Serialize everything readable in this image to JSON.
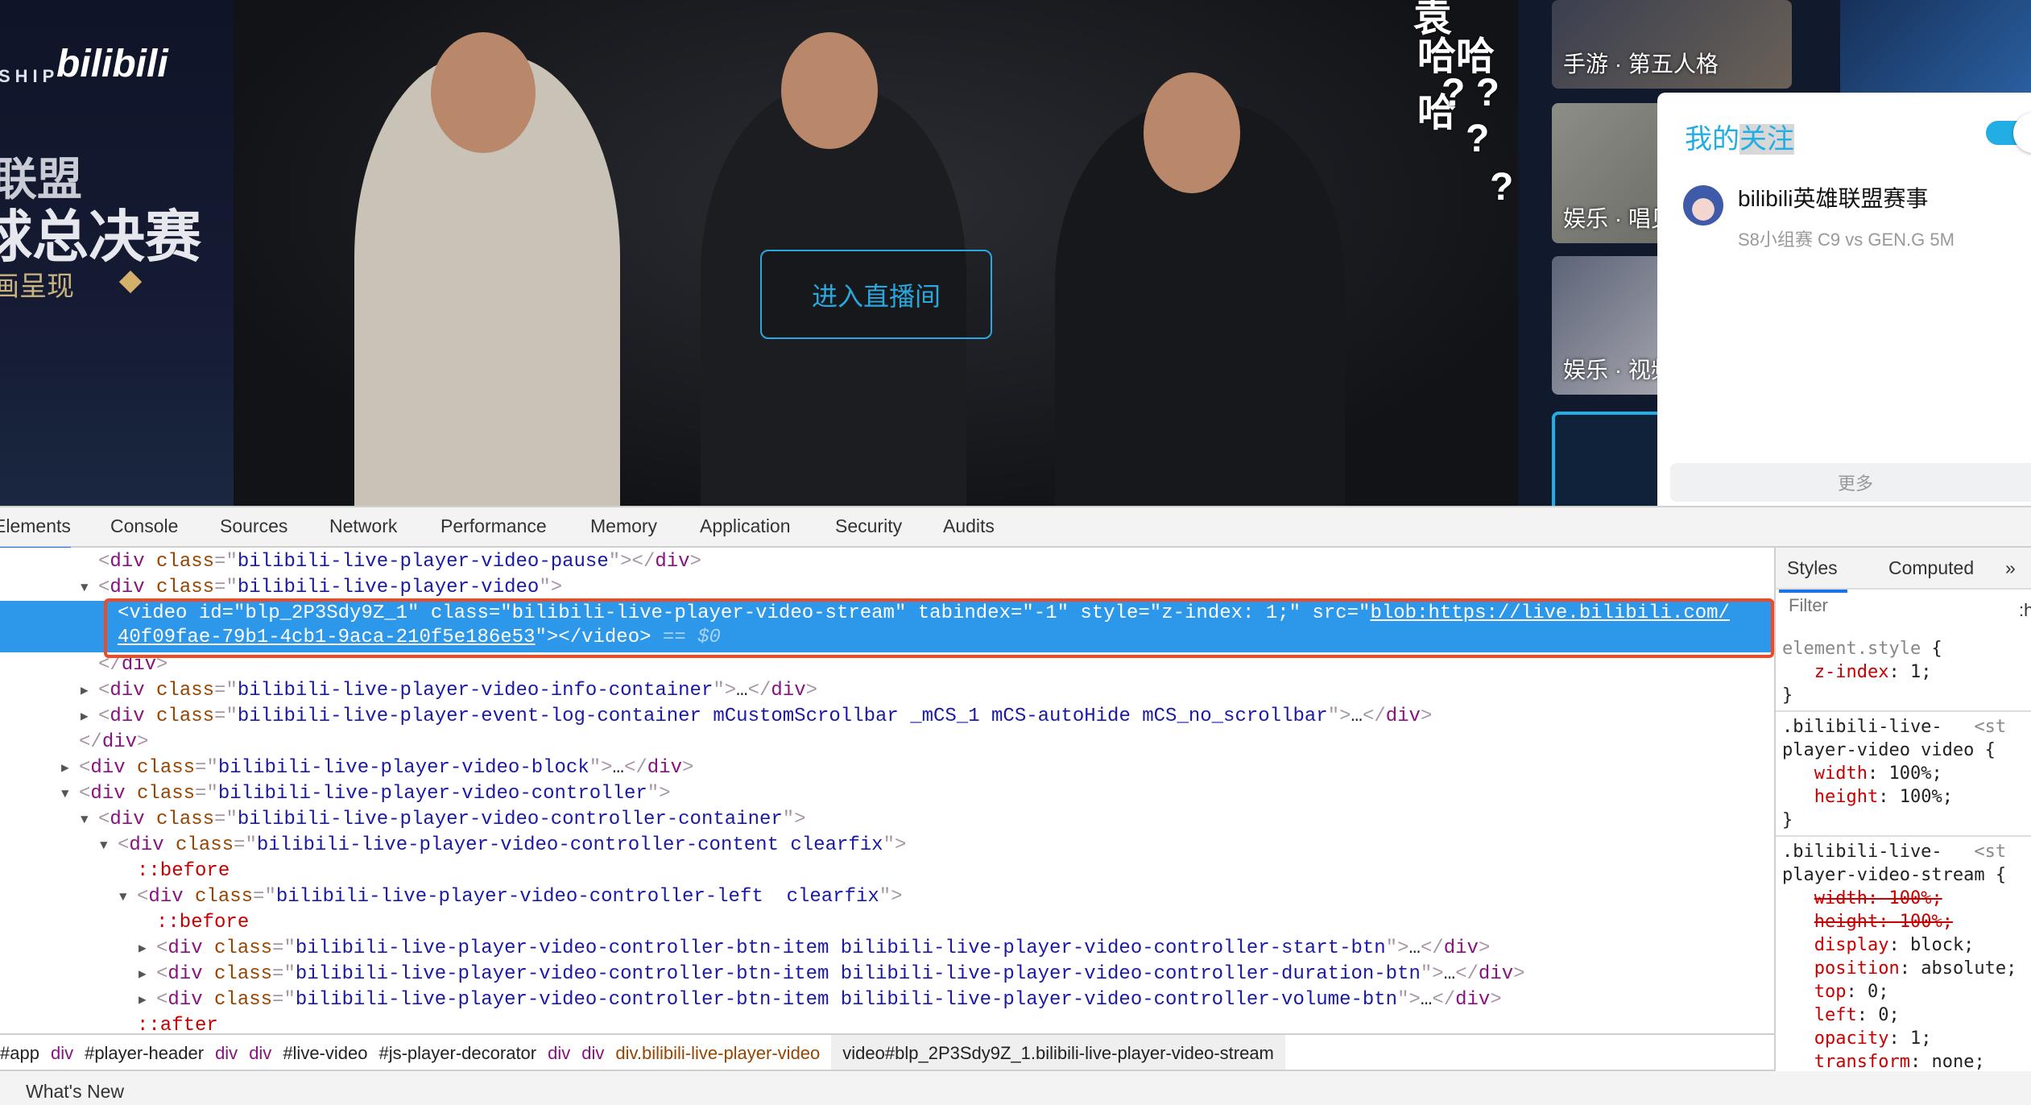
{
  "page": {
    "banner": {
      "ship": "SHIP",
      "logo": "bilibili",
      "line1": "联盟",
      "line2": "球总决赛",
      "line3": "画呈现"
    },
    "video": {
      "enter_button": "进入直播间",
      "danmaku": [
        "袁",
        "哈哈哈",
        "? ?",
        "?",
        "?"
      ]
    },
    "side_cards": [
      "手游 · 第五人格",
      "娱乐 · 唱见",
      "娱乐 · 视频"
    ],
    "follow_popup": {
      "title_a": "我的",
      "title_b": "关注",
      "toggle_on": true,
      "name": "bilibili英雄联盟赛事",
      "subtitle": "S8小组赛 C9 vs GEN.G 5M",
      "more": "更多"
    }
  },
  "devtools": {
    "tabs": [
      "Elements",
      "Console",
      "Sources",
      "Network",
      "Performance",
      "Memory",
      "Application",
      "Security",
      "Audits"
    ],
    "active_tab": "Elements",
    "dom_lines": [
      {
        "depth": 2,
        "arrow": "",
        "segs": [
          [
            "pc",
            "<"
          ],
          [
            "tg",
            "div"
          ],
          [
            "at",
            " class"
          ],
          [
            "pc",
            "=\""
          ],
          [
            "av",
            "bilibili-live-player-video-pause"
          ],
          [
            "pc",
            "\">"
          ],
          [
            "pc",
            "</"
          ],
          [
            "tg",
            "div"
          ],
          [
            "pc",
            ">"
          ]
        ]
      },
      {
        "depth": 2,
        "arrow": "down",
        "segs": [
          [
            "pc",
            "<"
          ],
          [
            "tg",
            "div"
          ],
          [
            "at",
            " class"
          ],
          [
            "pc",
            "=\""
          ],
          [
            "av",
            "bilibili-live-player-video"
          ],
          [
            "pc",
            "\">"
          ]
        ]
      },
      {
        "depth": 3,
        "arrow": "",
        "selected": true,
        "segs": [
          [
            "tg",
            "<video id=\"blp_2P3Sdy9Z_1\" class=\"bilibili-live-player-video-stream\" tabindex=\"-1\" style=\"z-index: 1;\" src=\""
          ],
          [
            "lk",
            "blob:https://live.bilibili.com/"
          ]
        ],
        "segs2": [
          [
            "lk",
            "40f09fae-79b1-4cb1-9aca-210f5e186e53"
          ],
          [
            "tg",
            "\"></video>"
          ],
          [
            "eq",
            " == $0"
          ]
        ]
      },
      {
        "depth": 2,
        "arrow": "",
        "segs": [
          [
            "pc",
            "</"
          ],
          [
            "tg",
            "div"
          ],
          [
            "pc",
            ">"
          ]
        ]
      },
      {
        "depth": 2,
        "arrow": "right",
        "segs": [
          [
            "pc",
            "<"
          ],
          [
            "tg",
            "div"
          ],
          [
            "at",
            " class"
          ],
          [
            "pc",
            "=\""
          ],
          [
            "av",
            "bilibili-live-player-video-info-container"
          ],
          [
            "pc",
            "\">"
          ],
          [
            "tx",
            "…"
          ],
          [
            "pc",
            "</"
          ],
          [
            "tg",
            "div"
          ],
          [
            "pc",
            ">"
          ]
        ]
      },
      {
        "depth": 2,
        "arrow": "right",
        "segs": [
          [
            "pc",
            "<"
          ],
          [
            "tg",
            "div"
          ],
          [
            "at",
            " class"
          ],
          [
            "pc",
            "=\""
          ],
          [
            "av",
            "bilibili-live-player-event-log-container mCustomScrollbar _mCS_1 mCS-autoHide mCS_no_scrollbar"
          ],
          [
            "pc",
            "\">"
          ],
          [
            "tx",
            "…"
          ],
          [
            "pc",
            "</"
          ],
          [
            "tg",
            "div"
          ],
          [
            "pc",
            ">"
          ]
        ]
      },
      {
        "depth": 1,
        "arrow": "",
        "segs": [
          [
            "pc",
            "</"
          ],
          [
            "tg",
            "div"
          ],
          [
            "pc",
            ">"
          ]
        ]
      },
      {
        "depth": 1,
        "arrow": "right",
        "segs": [
          [
            "pc",
            "<"
          ],
          [
            "tg",
            "div"
          ],
          [
            "at",
            " class"
          ],
          [
            "pc",
            "=\""
          ],
          [
            "av",
            "bilibili-live-player-video-block"
          ],
          [
            "pc",
            "\">"
          ],
          [
            "tx",
            "…"
          ],
          [
            "pc",
            "</"
          ],
          [
            "tg",
            "div"
          ],
          [
            "pc",
            ">"
          ]
        ]
      },
      {
        "depth": 1,
        "arrow": "down",
        "segs": [
          [
            "pc",
            "<"
          ],
          [
            "tg",
            "div"
          ],
          [
            "at",
            " class"
          ],
          [
            "pc",
            "=\""
          ],
          [
            "av",
            "bilibili-live-player-video-controller"
          ],
          [
            "pc",
            "\">"
          ]
        ]
      },
      {
        "depth": 2,
        "arrow": "down",
        "segs": [
          [
            "pc",
            "<"
          ],
          [
            "tg",
            "div"
          ],
          [
            "at",
            " class"
          ],
          [
            "pc",
            "=\""
          ],
          [
            "av",
            "bilibili-live-player-video-controller-container"
          ],
          [
            "pc",
            "\">"
          ]
        ]
      },
      {
        "depth": 3,
        "arrow": "down",
        "segs": [
          [
            "pc",
            "<"
          ],
          [
            "tg",
            "div"
          ],
          [
            "at",
            " class"
          ],
          [
            "pc",
            "=\""
          ],
          [
            "av",
            "bilibili-live-player-video-controller-content clearfix"
          ],
          [
            "pc",
            "\">"
          ]
        ]
      },
      {
        "depth": 4,
        "arrow": "",
        "segs": [
          [
            "ps",
            "::before"
          ]
        ]
      },
      {
        "depth": 4,
        "arrow": "down",
        "segs": [
          [
            "pc",
            "<"
          ],
          [
            "tg",
            "div"
          ],
          [
            "at",
            " class"
          ],
          [
            "pc",
            "=\""
          ],
          [
            "av",
            "bilibili-live-player-video-controller-left  clearfix"
          ],
          [
            "pc",
            "\">"
          ]
        ]
      },
      {
        "depth": 5,
        "arrow": "",
        "segs": [
          [
            "ps",
            "::before"
          ]
        ]
      },
      {
        "depth": 5,
        "arrow": "right",
        "segs": [
          [
            "pc",
            "<"
          ],
          [
            "tg",
            "div"
          ],
          [
            "at",
            " class"
          ],
          [
            "pc",
            "=\""
          ],
          [
            "av",
            "bilibili-live-player-video-controller-btn-item bilibili-live-player-video-controller-start-btn"
          ],
          [
            "pc",
            "\">"
          ],
          [
            "tx",
            "…"
          ],
          [
            "pc",
            "</"
          ],
          [
            "tg",
            "div"
          ],
          [
            "pc",
            ">"
          ]
        ]
      },
      {
        "depth": 5,
        "arrow": "right",
        "segs": [
          [
            "pc",
            "<"
          ],
          [
            "tg",
            "div"
          ],
          [
            "at",
            " class"
          ],
          [
            "pc",
            "=\""
          ],
          [
            "av",
            "bilibili-live-player-video-controller-btn-item bilibili-live-player-video-controller-duration-btn"
          ],
          [
            "pc",
            "\">"
          ],
          [
            "tx",
            "…"
          ],
          [
            "pc",
            "</"
          ],
          [
            "tg",
            "div"
          ],
          [
            "pc",
            ">"
          ]
        ]
      },
      {
        "depth": 5,
        "arrow": "right",
        "segs": [
          [
            "pc",
            "<"
          ],
          [
            "tg",
            "div"
          ],
          [
            "at",
            " class"
          ],
          [
            "pc",
            "=\""
          ],
          [
            "av",
            "bilibili-live-player-video-controller-btn-item bilibili-live-player-video-controller-volume-btn"
          ],
          [
            "pc",
            "\">"
          ],
          [
            "tx",
            "…"
          ],
          [
            "pc",
            "</"
          ],
          [
            "tg",
            "div"
          ],
          [
            "pc",
            ">"
          ]
        ]
      },
      {
        "depth": 4,
        "arrow": "",
        "segs": [
          [
            "ps",
            "::after"
          ]
        ]
      }
    ],
    "styles": {
      "tabs": [
        "Styles",
        "Computed",
        "»"
      ],
      "filter_placeholder": "Filter",
      "filter_extra": ":h"
    },
    "breadcrumbs": [
      {
        "t": "#app",
        "k": "c-id"
      },
      {
        "t": "div",
        "k": "c-el"
      },
      {
        "t": "#player-header",
        "k": "c-id"
      },
      {
        "t": "div",
        "k": "c-el"
      },
      {
        "t": "div",
        "k": "c-el"
      },
      {
        "t": "#live-video",
        "k": "c-id"
      },
      {
        "t": "#js-player-decorator",
        "k": "c-id"
      },
      {
        "t": "div",
        "k": "c-el"
      },
      {
        "t": "div",
        "k": "c-el"
      },
      {
        "t": "div.bilibili-live-player-video",
        "k": "c-cls"
      },
      {
        "t": "video#blp_2P3Sdy9Z_1.bilibili-live-player-video-stream",
        "k": "c-id cur"
      }
    ],
    "drawer_tab": "What's New"
  },
  "colors": {
    "accent": "#23ade5",
    "selection": "#2d97ea",
    "highlight_border": "#f04a24"
  }
}
